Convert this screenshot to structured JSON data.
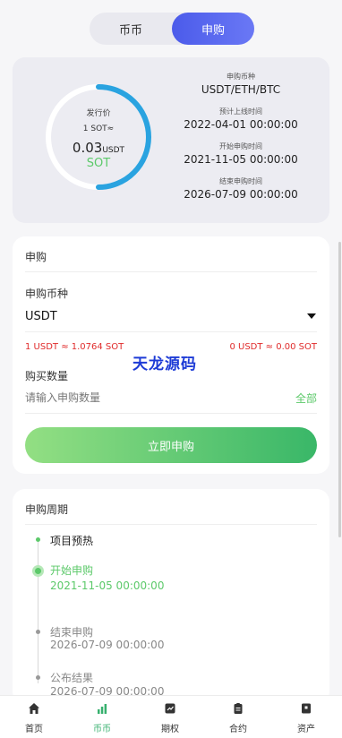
{
  "tabs": [
    {
      "label": "币币",
      "active": false
    },
    {
      "label": "申购",
      "active": true
    }
  ],
  "info": {
    "issue_price_label": "发行价",
    "rate_line": "1 SOT≈",
    "price_value": "0.03",
    "price_unit": "USDT",
    "token": "SOT",
    "progress": 0.5,
    "currency_label": "申购币种",
    "currency_value": "USDT/ETH/BTC",
    "listing_label": "预计上线时间",
    "listing_value": "2022-04-01 00:00:00",
    "start_label": "开始申购时间",
    "start_value": "2021-11-05 00:00:00",
    "end_label": "结束申购时间",
    "end_value": "2026-07-09 00:00:00"
  },
  "subscribe": {
    "title": "申购",
    "currency_label": "申购币种",
    "currency_value": "USDT",
    "rate_left": "1 USDT ≈ 1.0764 SOT",
    "rate_right": "0 USDT ≈ 0.00 SOT",
    "watermark": "天龙源码",
    "qty_label": "购买数量",
    "qty_placeholder": "请输入申购数量",
    "all_label": "全部",
    "button_label": "立即申购"
  },
  "period": {
    "title": "申购周期",
    "steps": [
      {
        "title": "项目预热",
        "time": ""
      },
      {
        "title": "开始申购",
        "time": "2021-11-05 00:00:00"
      },
      {
        "title": "结束申购",
        "time": "2026-07-09 00:00:00"
      },
      {
        "title": "公布结果",
        "time": "2026-07-09 00:00:00"
      }
    ]
  },
  "nav": [
    {
      "label": "首页",
      "icon": "home-icon",
      "active": false
    },
    {
      "label": "币币",
      "icon": "bar-chart-icon",
      "active": true
    },
    {
      "label": "期权",
      "icon": "options-icon",
      "active": false
    },
    {
      "label": "合约",
      "icon": "contract-icon",
      "active": false
    },
    {
      "label": "资产",
      "icon": "wallet-icon",
      "active": false
    }
  ],
  "colors": {
    "accent_blue": "#4b5bea",
    "accent_green": "#5cc96a",
    "rate_red": "#e02b2b",
    "ring_blue": "#2aa3e0"
  }
}
